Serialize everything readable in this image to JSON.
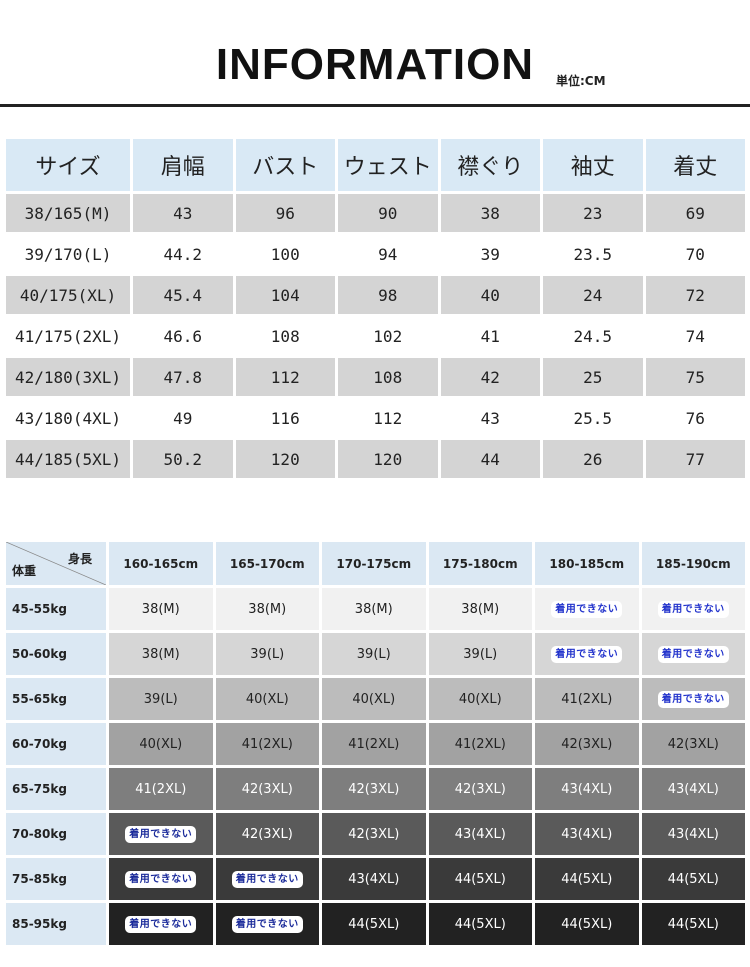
{
  "header": {
    "title": "INFORMATION",
    "unit": "単位:CM"
  },
  "size_table": {
    "headers": [
      "サイズ",
      "肩幅",
      "バスト",
      "ウェスト",
      "襟ぐり",
      "袖丈",
      "着丈"
    ],
    "rows": [
      [
        "38/165(M)",
        "43",
        "96",
        "90",
        "38",
        "23",
        "69"
      ],
      [
        "39/170(L)",
        "44.2",
        "100",
        "94",
        "39",
        "23.5",
        "70"
      ],
      [
        "40/175(XL)",
        "45.4",
        "104",
        "98",
        "40",
        "24",
        "72"
      ],
      [
        "41/175(2XL)",
        "46.6",
        "108",
        "102",
        "41",
        "24.5",
        "74"
      ],
      [
        "42/180(3XL)",
        "47.8",
        "112",
        "108",
        "42",
        "25",
        "75"
      ],
      [
        "43/180(4XL)",
        "49",
        "116",
        "112",
        "43",
        "25.5",
        "76"
      ],
      [
        "44/185(5XL)",
        "50.2",
        "120",
        "120",
        "44",
        "26",
        "77"
      ]
    ]
  },
  "fit_table": {
    "corner_height": "身長",
    "corner_weight": "体重",
    "heights": [
      "160-165cm",
      "165-170cm",
      "170-175cm",
      "175-180cm",
      "180-185cm",
      "185-190cm"
    ],
    "rows": [
      {
        "weight": "45-55kg",
        "cells": [
          "38(M)",
          "38(M)",
          "38(M)",
          "38(M)",
          "着用できない",
          "着用できない"
        ]
      },
      {
        "weight": "50-60kg",
        "cells": [
          "38(M)",
          "39(L)",
          "39(L)",
          "39(L)",
          "着用できない",
          "着用できない"
        ]
      },
      {
        "weight": "55-65kg",
        "cells": [
          "39(L)",
          "40(XL)",
          "40(XL)",
          "40(XL)",
          "41(2XL)",
          "着用できない"
        ]
      },
      {
        "weight": "60-70kg",
        "cells": [
          "40(XL)",
          "41(2XL)",
          "41(2XL)",
          "41(2XL)",
          "42(3XL)",
          "42(3XL)"
        ]
      },
      {
        "weight": "65-75kg",
        "cells": [
          "41(2XL)",
          "42(3XL)",
          "42(3XL)",
          "42(3XL)",
          "43(4XL)",
          "43(4XL)"
        ]
      },
      {
        "weight": "70-80kg",
        "cells": [
          "着用できない",
          "42(3XL)",
          "42(3XL)",
          "43(4XL)",
          "43(4XL)",
          "43(4XL)"
        ]
      },
      {
        "weight": "75-85kg",
        "cells": [
          "着用できない",
          "着用できない",
          "43(4XL)",
          "44(5XL)",
          "44(5XL)",
          "44(5XL)"
        ]
      },
      {
        "weight": "85-95kg",
        "cells": [
          "着用できない",
          "着用できない",
          "44(5XL)",
          "44(5XL)",
          "44(5XL)",
          "44(5XL)"
        ]
      }
    ]
  },
  "colors": {
    "header_bg": "#d9e9f5",
    "row_shade": "#d4d4d4",
    "not_available_text": "#2233cc"
  }
}
